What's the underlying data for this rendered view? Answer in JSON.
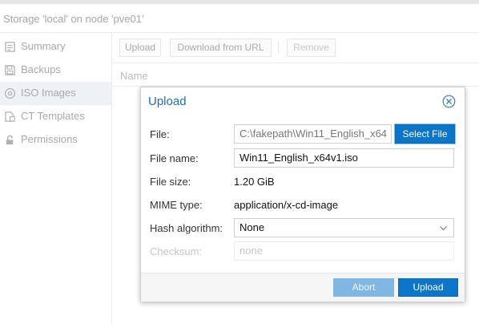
{
  "header": {
    "title": "Storage 'local' on node 'pve01'"
  },
  "sidebar": {
    "items": [
      {
        "label": "Summary",
        "icon": "summary-icon"
      },
      {
        "label": "Backups",
        "icon": "floppy-icon"
      },
      {
        "label": "ISO Images",
        "icon": "disc-icon",
        "active": true
      },
      {
        "label": "CT Templates",
        "icon": "template-icon"
      },
      {
        "label": "Permissions",
        "icon": "unlock-icon"
      }
    ]
  },
  "toolbar": {
    "upload_label": "Upload",
    "download_label": "Download from URL",
    "remove_label": "Remove"
  },
  "grid": {
    "column_name": "Name"
  },
  "dialog": {
    "title": "Upload",
    "file_label": "File:",
    "file_value": "C:\\fakepath\\Win11_English_x64",
    "select_file_label": "Select File",
    "filename_label": "File name:",
    "filename_value": "Win11_English_x64v1.iso",
    "filesize_label": "File size:",
    "filesize_value": "1.20 GiB",
    "mime_label": "MIME type:",
    "mime_value": "application/x-cd-image",
    "hash_label": "Hash algorithm:",
    "hash_value": "None",
    "checksum_label": "Checksum:",
    "checksum_placeholder": "none",
    "abort_label": "Abort",
    "upload_label": "Upload"
  },
  "colors": {
    "accent": "#0a75c9",
    "title_blue": "#1d6fb6",
    "disabled_button": "#7fb6e2"
  }
}
